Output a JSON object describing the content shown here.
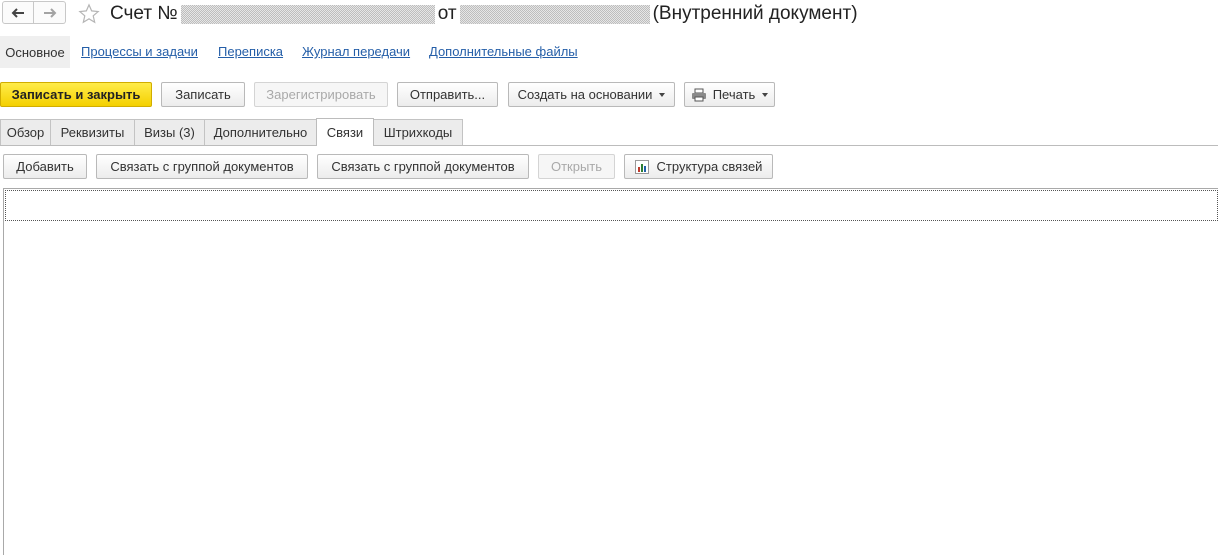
{
  "header": {
    "back_icon": "arrow-left-icon",
    "forward_icon": "arrow-right-icon",
    "favorite_icon": "star-outline-icon",
    "title_prefix": "Счет №",
    "title_middle": "от",
    "title_suffix": "(Внутренний документ)"
  },
  "sections": {
    "active": "Основное",
    "links": [
      "Процессы и задачи",
      "Переписка",
      "Журнал передачи",
      "Дополнительные файлы"
    ]
  },
  "toolbar": {
    "save_close": "Записать и закрыть",
    "save": "Записать",
    "register": "Зарегистрировать",
    "send": "Отправить...",
    "create_based": "Создать на основании",
    "print": "Печать",
    "print_icon": "printer-icon"
  },
  "tabs": [
    "Обзор",
    "Реквизиты",
    "Визы (3)",
    "Дополнительно",
    "Связи",
    "Штрихкоды"
  ],
  "active_tab": "Связи",
  "links_toolbar": {
    "add": "Добавить",
    "link_group_1": "Связать с группой документов",
    "link_group_2": "Связать с группой документов",
    "open": "Открыть",
    "structure": "Структура связей",
    "structure_icon": "chart-icon"
  },
  "colors": {
    "primary_button": "#f4d000",
    "link": "#245ea8"
  }
}
